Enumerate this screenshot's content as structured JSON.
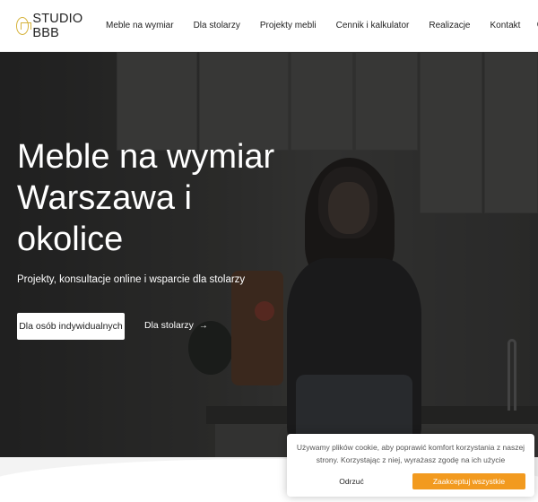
{
  "header": {
    "logo_text": "STUDIO BBB",
    "nav": [
      "Meble na wymiar",
      "Dla stolarzy",
      "Projekty mebli",
      "Cennik i kalkulator",
      "Realizacje",
      "Kontakt"
    ],
    "search_icon": "search-icon"
  },
  "hero": {
    "title": "Meble na wymiar Warszawa i okolice",
    "subtitle": "Projekty, konsultacje online i wsparcie dla stolarzy",
    "primary_button": "Dla osób indywidualnych",
    "secondary_link": "Dla stolarzy",
    "secondary_arrow": "→"
  },
  "cookie": {
    "text": "Używamy plików cookie, aby poprawić komfort korzystania z naszej strony. Korzystając z niej, wyrażasz zgodę na ich użycie",
    "reject": "Odrzuć",
    "accept": "Zaakceptuj wszystkie"
  },
  "colors": {
    "accent": "#f29a1f",
    "logo": "#d6b33c"
  }
}
